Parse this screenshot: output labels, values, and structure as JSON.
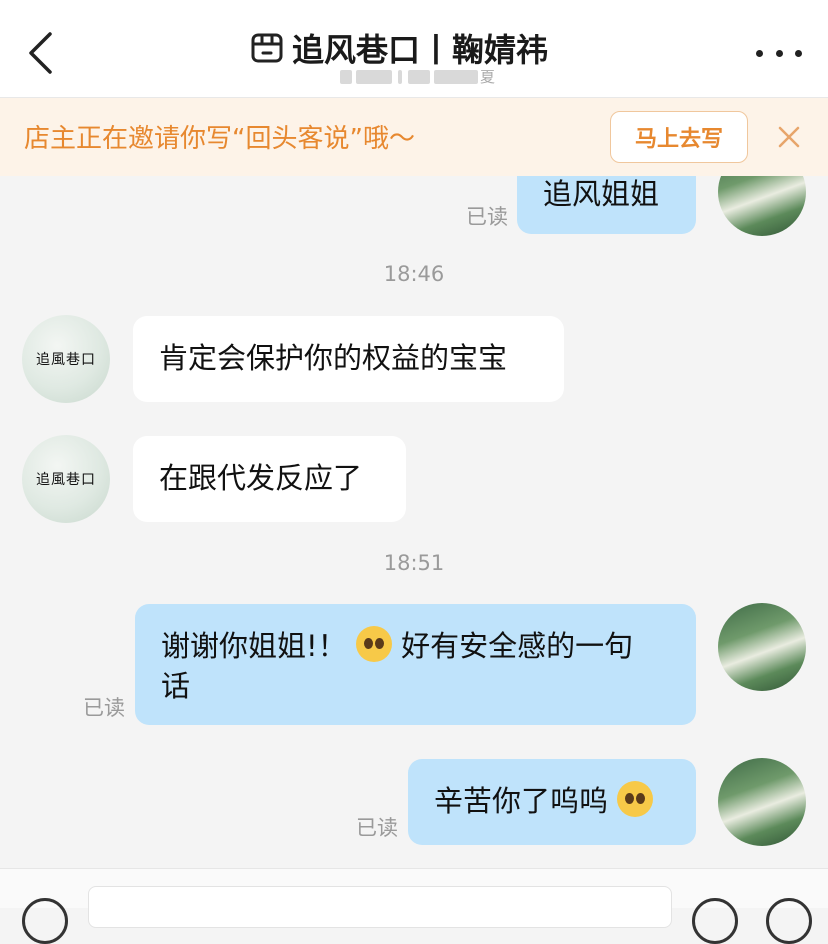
{
  "header": {
    "title": "追风巷口丨鞠婧祎",
    "subtitle": "夏"
  },
  "banner": {
    "text": "店主正在邀请你写“回头客说”哦～",
    "button_label": "马上去写"
  },
  "messages": [
    {
      "from": "me",
      "text": "追风姐姐",
      "status": "已读"
    },
    {
      "time": "18:46"
    },
    {
      "from": "shop",
      "text": "肯定会保护你的权益的宝宝"
    },
    {
      "from": "shop",
      "text": "在跟代发反应了"
    },
    {
      "time": "18:51"
    },
    {
      "from": "me",
      "text_line1": "谢谢你姐姐!！",
      "text_line1b": "好有安全感的一句",
      "text_line2": "话",
      "emoji": "pleading-face",
      "status": "已读"
    },
    {
      "from": "me",
      "text": "辛苦你了呜呜",
      "emoji": "pleading-face",
      "status": "已读"
    }
  ],
  "shop_avatar_text": "追風巷口",
  "colors": {
    "banner_bg": "#fdf3e8",
    "banner_text": "#e7882f",
    "my_bubble": "#bfe3fb",
    "shop_bubble": "#ffffff"
  }
}
